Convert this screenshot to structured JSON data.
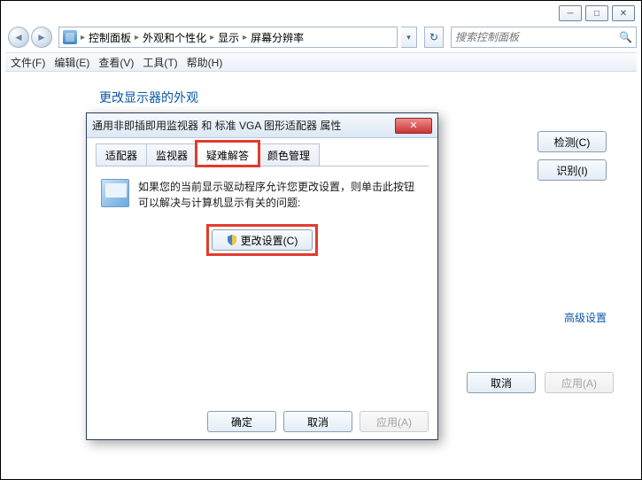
{
  "titlebar": {
    "minimize": "─",
    "maximize": "□",
    "close": "✕"
  },
  "breadcrumb": {
    "items": [
      "控制面板",
      "外观和个性化",
      "显示",
      "屏幕分辨率"
    ]
  },
  "search": {
    "placeholder": "搜索控制面板"
  },
  "menubar": {
    "file": "文件(F)",
    "edit": "编辑(E)",
    "view": "查看(V)",
    "tools": "工具(T)",
    "help": "帮助(H)"
  },
  "content": {
    "heading": "更改显示器的外观",
    "detect": "检测(C)",
    "identify": "识别(I)",
    "advanced_link": "高级设置",
    "cancel": "取消",
    "apply": "应用(A)"
  },
  "dialog": {
    "title": "通用非即插即用监视器 和 标准 VGA 图形适配器 属性",
    "tabs": {
      "adapter": "适配器",
      "monitor": "监视器",
      "troubleshoot": "疑难解答",
      "color": "颜色管理"
    },
    "ts_text_1": "如果您的当前显示驱动程序允许您更改设置，则单击此按钮",
    "ts_text_2": "可以解决与计算机显示有关的问题:",
    "change_settings": "更改设置(C)",
    "ok": "确定",
    "cancel": "取消",
    "apply": "应用(A)"
  }
}
